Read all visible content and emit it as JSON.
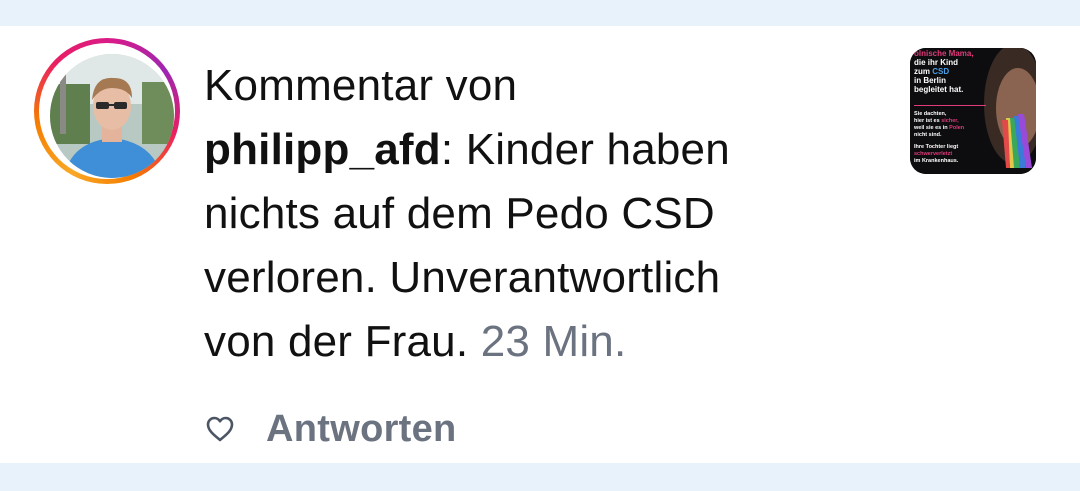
{
  "comment": {
    "prefix": "Kommentar von",
    "username": "philipp_afd",
    "separator": ":",
    "body_line1": " Kinder haben",
    "body_line2": "nichts auf dem Pedo CSD",
    "body_line3": "verloren. Unverantwortlich",
    "body_line4": "von der Frau.",
    "timestamp": "23 Min."
  },
  "actions": {
    "like_icon": "heart-outline-icon",
    "reply_label": "Antworten"
  },
  "thumbnail": {
    "line1": "olnische Mama,",
    "line2": "die ihr Kind",
    "line3a": "zum ",
    "line3b": "CSD",
    "line4": "in Berlin",
    "line5": "begleitet hat.",
    "line6": "Sie dachten,",
    "line7a": "hier ist es ",
    "line7b": "sicher,",
    "line8a": "weil sie es in ",
    "line8b": "Polen",
    "line9": "nicht sind.",
    "line10": "Ihre Tochter liegt",
    "line11": "schwerverletzt",
    "line12": "im Krankenhaus."
  },
  "colors": {
    "page_background": "#e8f2fb",
    "card_background": "#ffffff",
    "text": "#111111",
    "muted": "#6b7280",
    "ring_gradient": [
      "#f9a825",
      "#e91e63",
      "#9c27b0"
    ],
    "thumb_accent": "#e23a7a"
  }
}
